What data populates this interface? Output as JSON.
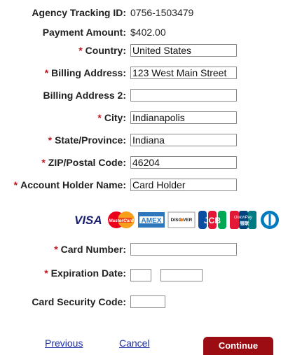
{
  "fields": {
    "agency_tracking": {
      "label": "Agency Tracking ID:",
      "value": "0756-1503479"
    },
    "payment_amount": {
      "label": "Payment Amount:",
      "value": "$402.00"
    },
    "country": {
      "label": "Country:",
      "value": "United States",
      "required": "*"
    },
    "billing_address": {
      "label": "Billing Address:",
      "value": "123 West Main Street",
      "required": "*"
    },
    "billing_address_2": {
      "label": "Billing Address 2:",
      "value": ""
    },
    "city": {
      "label": "City:",
      "value": "Indianapolis",
      "required": "*"
    },
    "state": {
      "label": "State/Province:",
      "value": "Indiana",
      "required": "*"
    },
    "zip": {
      "label": "ZIP/Postal Code:",
      "value": "46204",
      "required": "*"
    },
    "account_holder": {
      "label": "Account Holder Name:",
      "value": "Card Holder",
      "required": "*"
    },
    "card_number": {
      "label": "Card Number:",
      "value": "",
      "required": "*"
    },
    "expiration": {
      "label": "Expiration Date:",
      "month": "",
      "year": "",
      "required": "*"
    },
    "security_code": {
      "label": "Card Security Code:",
      "value": ""
    }
  },
  "cards": {
    "visa": "VISA",
    "mastercard": "MasterCard",
    "amex": "AMEX",
    "discover": "DISC VER",
    "jcb": "JCB",
    "unionpay_line1": "UnionPay",
    "unionpay_line2": "银联"
  },
  "footer": {
    "previous": "Previous",
    "cancel": "Cancel",
    "continue": "Continue"
  },
  "colors": {
    "required": "#c0161d",
    "link": "#1a2ea8",
    "button": "#9b0d12"
  }
}
